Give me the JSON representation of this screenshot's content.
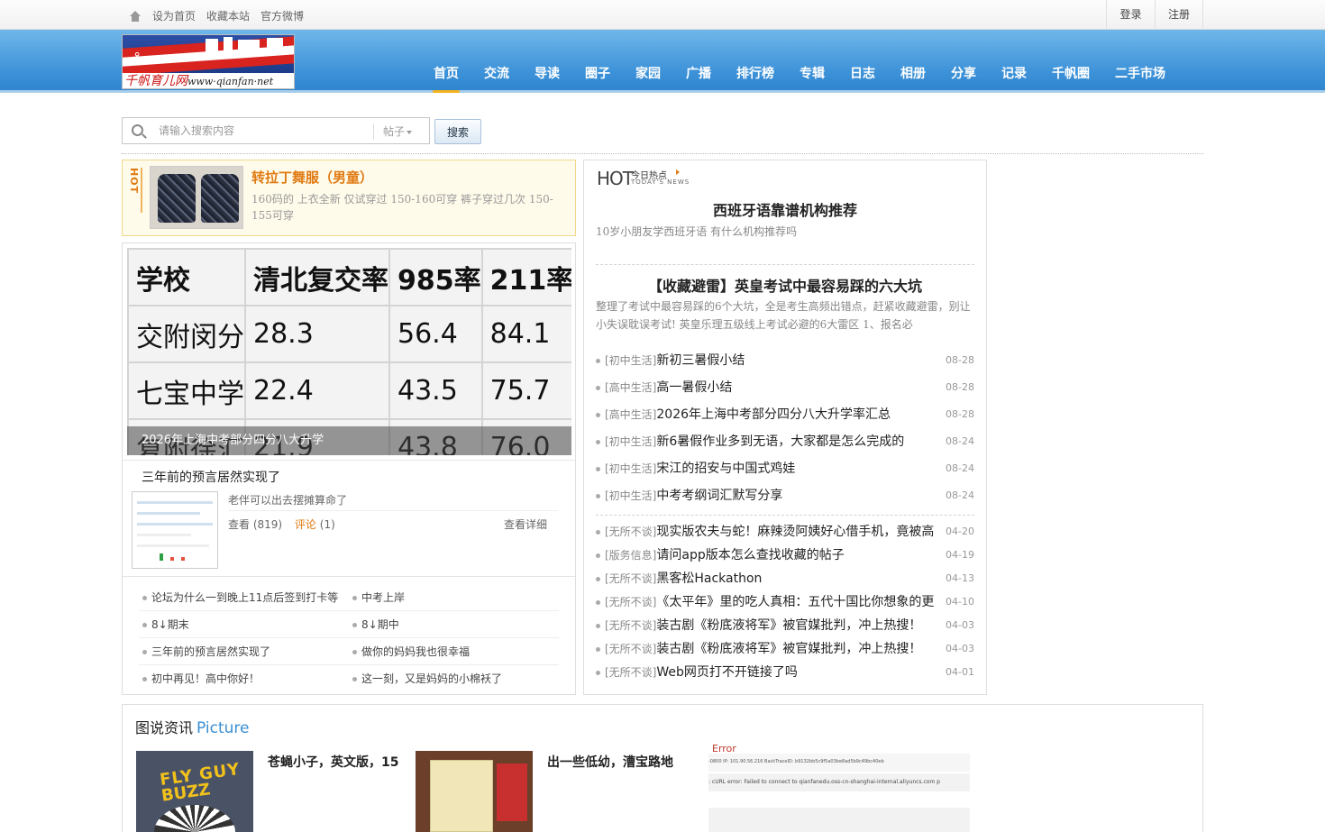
{
  "topbar": {
    "set_home": "设为首页",
    "bookmark": "收藏本站",
    "weibo": "官方微博",
    "login": "登录",
    "register": "注册"
  },
  "logo": {
    "cn": "千帆育儿网",
    "url": "www·qianfan·net"
  },
  "nav": [
    {
      "label": "首页",
      "active": true
    },
    {
      "label": "交流"
    },
    {
      "label": "导读"
    },
    {
      "label": "圈子"
    },
    {
      "label": "家园"
    },
    {
      "label": "广播"
    },
    {
      "label": "排行榜"
    },
    {
      "label": "专辑"
    },
    {
      "label": "日志"
    },
    {
      "label": "相册"
    },
    {
      "label": "分享"
    },
    {
      "label": "记录"
    },
    {
      "label": "千帆圈"
    },
    {
      "label": "二手市场"
    }
  ],
  "search": {
    "placeholder": "请输入搜索内容",
    "scope": "帖子",
    "button": "搜索"
  },
  "hot": {
    "tag": "HOT",
    "title": "转拉丁舞服（男童）",
    "desc": "160码的 上衣全新 仅试穿过 150-160可穿 裤子穿过几次 150-155可穿"
  },
  "slide": {
    "table": [
      [
        "学校",
        "清北复交率",
        "985率",
        "211率"
      ],
      [
        "交附闵分",
        "28.3",
        "56.4",
        "84.1"
      ],
      [
        "七宝中学",
        "22.4",
        "43.5",
        "75.7"
      ],
      [
        "复附徐汇",
        "21.9",
        "43.8",
        "76.0"
      ]
    ],
    "caption": "2026年上海中考部分四分八大升学"
  },
  "topic": {
    "title": "三年前的预言居然实现了",
    "desc": "老伴可以出去摆摊算命了",
    "views": "查看 (819)",
    "comments_label": "评论",
    "comments_count": "(1)",
    "detail": "查看详细"
  },
  "small_list": [
    [
      "论坛为什么一到晚上11点后签到打卡等",
      "中考上岸"
    ],
    [
      "8↓期末",
      "8↓期中"
    ],
    [
      "三年前的预言居然实现了",
      "做你的妈妈我也很幸福"
    ],
    [
      "初中再见！高中你好！",
      "这一刻，又是妈妈的小棉袄了"
    ]
  ],
  "today_hot": {
    "logo_big": "HOT",
    "logo_cn": "今日热点",
    "logo_en": "TODAY'S NEWS"
  },
  "featured": [
    {
      "title": "西班牙语靠谱机构推荐",
      "desc": "10岁小朋友学西班牙语 有什么机构推荐吗"
    },
    {
      "title": "【收藏避雷】英皇考试中最容易踩的六大坑",
      "desc": "整理了考试中最容易踩的6个大坑，全是考生高频出错点，赶紧收藏避雷，别让小失误耽误考试! 英皇乐理五级线上考试必避的6大雷区 1、报名必"
    }
  ],
  "news1": [
    {
      "cat": "[初中生活]",
      "title": "新初三暑假小结",
      "date": "08-28"
    },
    {
      "cat": "[高中生活]",
      "title": "高一暑假小结",
      "date": "08-28"
    },
    {
      "cat": "[高中生活]",
      "title": "2026年上海中考部分四分八大升学率汇总",
      "date": "08-28"
    },
    {
      "cat": "[初中生活]",
      "title": "新6暑假作业多到无语，大家都是怎么完成的",
      "date": "08-24"
    },
    {
      "cat": "[初中生活]",
      "title": "宋江的招安与中国式鸡娃",
      "date": "08-24"
    },
    {
      "cat": "[初中生活]",
      "title": "中考考纲词汇默写分享",
      "date": "08-24"
    }
  ],
  "news2": [
    {
      "cat": "[无所不谈]",
      "title": "现实版农夫与蛇！麻辣烫阿姨好心借手机，竟被高",
      "date": "04-20"
    },
    {
      "cat": "[版务信息]",
      "title": "请问app版本怎么查找收藏的帖子",
      "date": "04-19"
    },
    {
      "cat": "[无所不谈]",
      "title": "黑客松Hackathon",
      "date": "04-13"
    },
    {
      "cat": "[无所不谈]",
      "title": "《太平年》里的吃人真相：五代十国比你想象的更",
      "date": "04-10"
    },
    {
      "cat": "[无所不谈]",
      "title": "装古剧《粉底液将军》被官媒批判，冲上热搜！",
      "date": "04-03"
    },
    {
      "cat": "[无所不谈]",
      "title": "装古剧《粉底液将军》被官媒批判，冲上热搜！",
      "date": "04-03"
    },
    {
      "cat": "[无所不谈]",
      "title": "Web网页打不开链接了吗",
      "date": "04-01"
    }
  ],
  "pictures": {
    "heading_cn": "图说资讯",
    "heading_en": "Picture",
    "item1": {
      "title": "苍蝇小子，英文版，15",
      "img_text1": "FLY GUY",
      "img_text2": "BUZZ"
    },
    "item2": {
      "title": "出一些低幼，漕宝路地"
    },
    "item3": {
      "error": "Error",
      "line1": "-0800 IP: 101.90.56.216 BackTraceID: b9132bb5c9f5a03be8ad5b9c49bc40eb",
      "line2": ": cURL error: Failed to connect to qianfanedu.oss-cn-shanghai-internal.aliyuncs.com p"
    }
  }
}
